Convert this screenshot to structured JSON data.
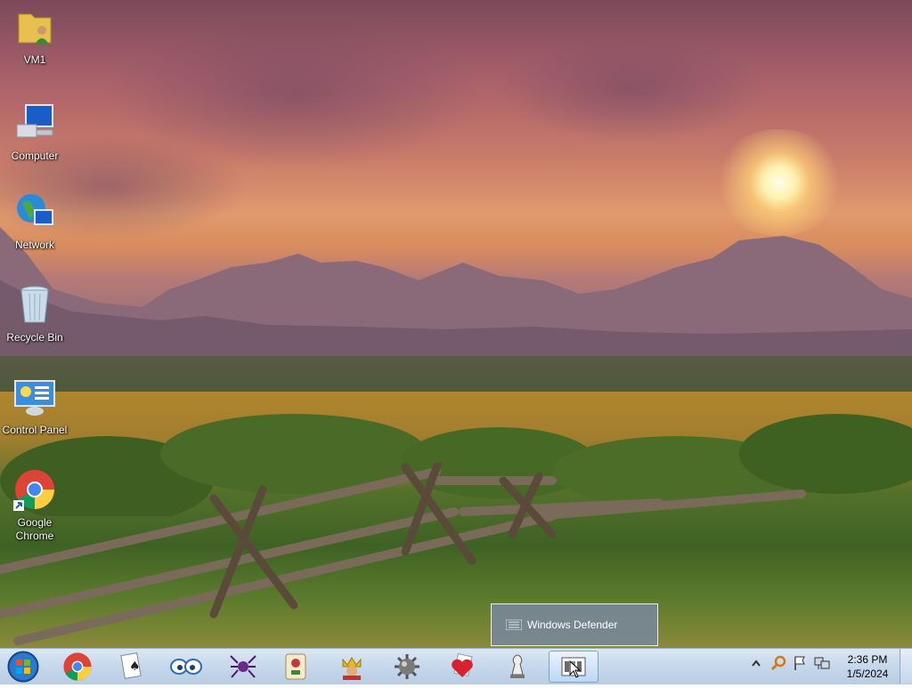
{
  "desktop": {
    "wallpaper": "sunset meadow with mountains and wooden fence",
    "icons": [
      {
        "label": "VM1",
        "icon": "user-folder-icon"
      },
      {
        "label": "Computer",
        "icon": "computer-icon"
      },
      {
        "label": "Network",
        "icon": "network-icon"
      },
      {
        "label": "Recycle Bin",
        "icon": "recycle-bin-icon"
      },
      {
        "label": "Control Panel",
        "icon": "control-panel-icon"
      },
      {
        "label": "Google Chrome",
        "icon": "chrome-icon"
      }
    ]
  },
  "tooltip": {
    "text": "Windows Defender",
    "icon": "windows-defender-icon"
  },
  "taskbar": {
    "start": "start-orb-icon",
    "pinned": [
      {
        "name": "chrome",
        "icon": "chrome-icon"
      },
      {
        "name": "solitaire",
        "icon": "solitaire-icon"
      },
      {
        "name": "purble-place",
        "icon": "purble-place-icon"
      },
      {
        "name": "spider-solitaire",
        "icon": "spider-solitaire-icon"
      },
      {
        "name": "mahjong-titans",
        "icon": "mahjong-icon"
      },
      {
        "name": "hearts",
        "icon": "king-card-icon"
      },
      {
        "name": "minesweeper",
        "icon": "minesweeper-icon"
      },
      {
        "name": "hearts-game",
        "icon": "heart-icon"
      },
      {
        "name": "chess-titans",
        "icon": "chess-icon"
      },
      {
        "name": "windows-defender",
        "icon": "windows-defender-icon",
        "active": true
      }
    ],
    "tray": {
      "icons": [
        "show-hidden-icons-chevron",
        "search-icon",
        "flag-icon",
        "network-status-icon"
      ],
      "time": "2:36 PM",
      "date": "1/5/2024"
    }
  },
  "colors": {
    "taskbar": "#c8d9ec",
    "tooltip_bg": "#788796",
    "accent": "#1e90ff"
  }
}
